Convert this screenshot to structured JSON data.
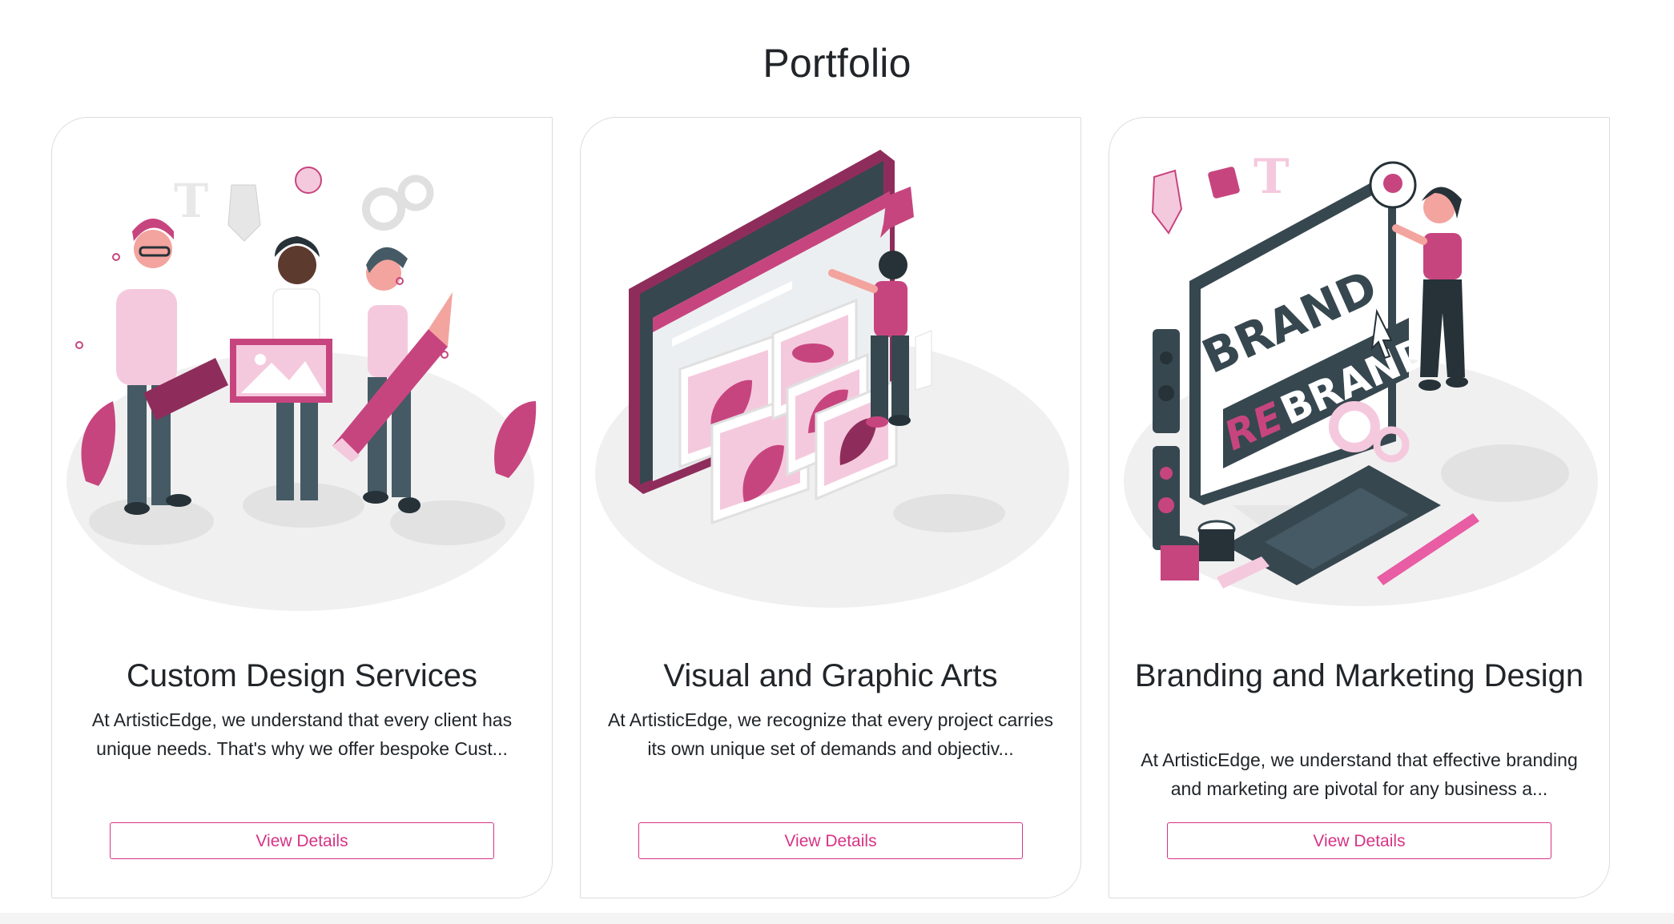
{
  "section": {
    "title": "Portfolio"
  },
  "cards": [
    {
      "title": "Custom Design Services",
      "text": "At ArtisticEdge, we understand that every client has unique needs. That's why we offer bespoke Cust...",
      "button": "View Details",
      "illustration": "design-team-illustration"
    },
    {
      "title": "Visual and Graphic Arts",
      "text": "At ArtisticEdge, we recognize that every project carries its own unique set of demands and objectiv...",
      "button": "View Details",
      "illustration": "art-gallery-screen-illustration"
    },
    {
      "title": "Branding and Marketing Design",
      "text": "At ArtisticEdge, we understand that effective branding and marketing are pivotal for any business a...",
      "button": "View Details",
      "illustration": "rebrand-monitor-illustration",
      "illustration_text": {
        "brand": "BRAND",
        "rebrand_re": "RE",
        "rebrand_rest": "BRAND",
        "t_letter": "T"
      }
    }
  ],
  "colors": {
    "accent": "#d63384",
    "illustration_pink": "#c7457f",
    "dark_gray": "#37474f",
    "light_pink": "#f5c9dd"
  }
}
